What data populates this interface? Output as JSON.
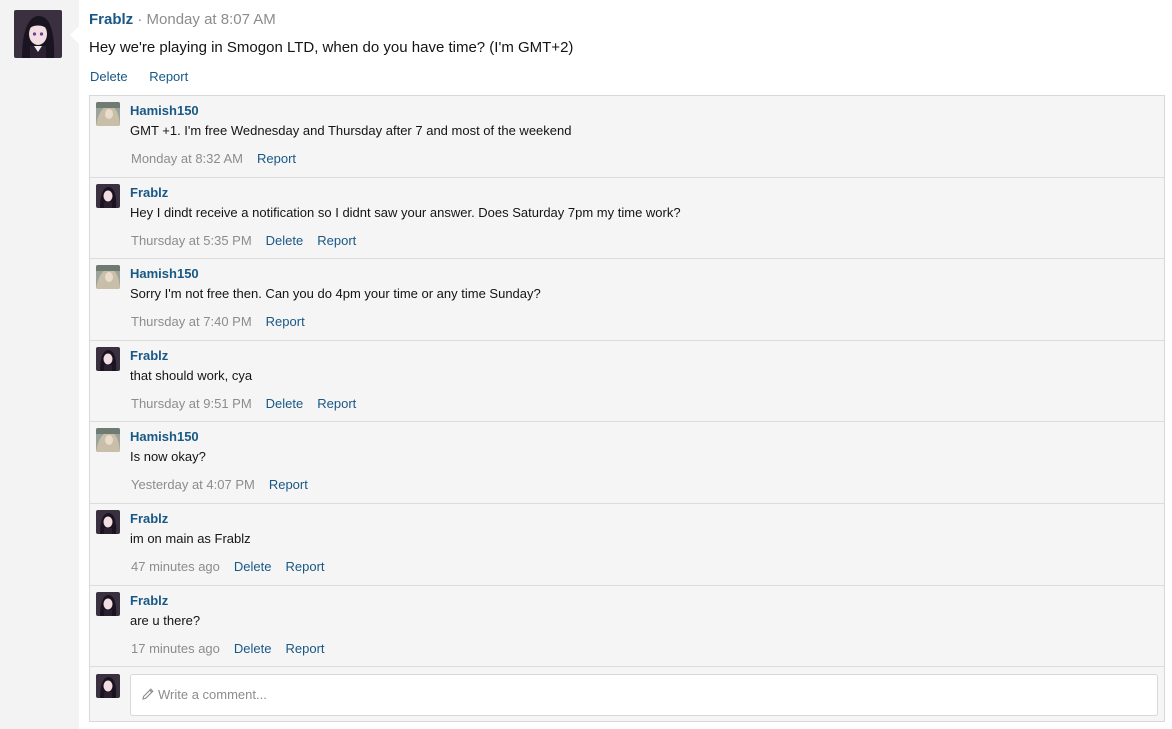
{
  "post": {
    "author": "Frablz",
    "separator": "·",
    "time": "Monday at 8:07 AM",
    "text": "Hey we're playing in Smogon LTD, when do you have time? (I'm GMT+2)",
    "actions": {
      "delete": "Delete",
      "report": "Report"
    }
  },
  "comments": [
    {
      "author": "Hamish150",
      "text": "GMT +1. I'm free Wednesday and Thursday after 7 and most of the weekend",
      "time": "Monday at 8:32 AM",
      "delete": "",
      "report": "Report"
    },
    {
      "author": "Frablz",
      "text": "Hey I dindt receive a notification so I didnt saw your answer. Does Saturday 7pm my time work?",
      "time": "Thursday at 5:35 PM",
      "delete": "Delete",
      "report": "Report"
    },
    {
      "author": "Hamish150",
      "text": "Sorry I'm not free then. Can you do 4pm your time or any time Sunday?",
      "time": "Thursday at 7:40 PM",
      "delete": "",
      "report": "Report"
    },
    {
      "author": "Frablz",
      "text": "that should work, cya",
      "time": "Thursday at 9:51 PM",
      "delete": "Delete",
      "report": "Report"
    },
    {
      "author": "Hamish150",
      "text": "Is now okay?",
      "time": "Yesterday at 4:07 PM",
      "delete": "",
      "report": "Report"
    },
    {
      "author": "Frablz",
      "text": "im on main as Frablz",
      "time": "47 minutes ago",
      "delete": "Delete",
      "report": "Report"
    },
    {
      "author": "Frablz",
      "text": "are u there?",
      "time": "17 minutes ago",
      "delete": "Delete",
      "report": "Report"
    }
  ],
  "compose": {
    "placeholder": "Write a comment..."
  },
  "icons": {
    "compose": "pencil-icon"
  },
  "colors": {
    "link": "#185886",
    "muted": "#8c8c8c",
    "panel": "#f5f5f5"
  }
}
